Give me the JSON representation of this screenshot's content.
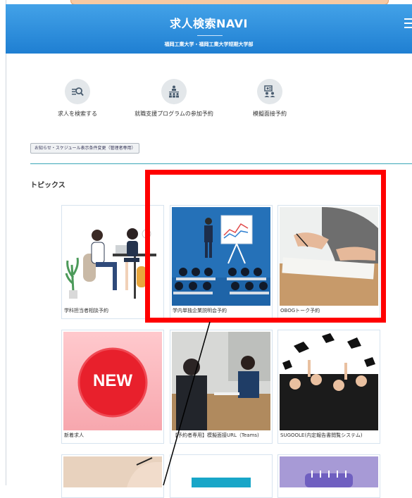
{
  "header": {
    "title": "求人検索NAVI",
    "subtitle": "福岡工業大学・福岡工業大学短期大学部"
  },
  "quick_links": [
    {
      "label": "求人を検索する",
      "icon": "job-search-icon"
    },
    {
      "label": "就職支援プログラムの参加予約",
      "icon": "program-reservation-icon"
    },
    {
      "label": "模擬面接予約",
      "icon": "mock-interview-icon"
    }
  ],
  "notice_button": "お知らせ・スケジュール表示条件変更（管理者専用）",
  "topics": {
    "heading": "トピックス",
    "cards": [
      {
        "caption": "学科担当者相談予約"
      },
      {
        "caption": "学内単独企業説明会予約"
      },
      {
        "caption": "OBOGトーク予約"
      },
      {
        "caption": "新着求人",
        "badge": "NEW"
      },
      {
        "caption": "【予約者専用】模擬面接URL（Teams)"
      },
      {
        "caption": "SUGOOLE(内定報告書閲覧システム)"
      }
    ]
  },
  "colors": {
    "header_top": "#43a2e8",
    "header_bottom": "#1f7fd2",
    "highlight": "#ff0000",
    "divider": "#3aa7b8"
  }
}
